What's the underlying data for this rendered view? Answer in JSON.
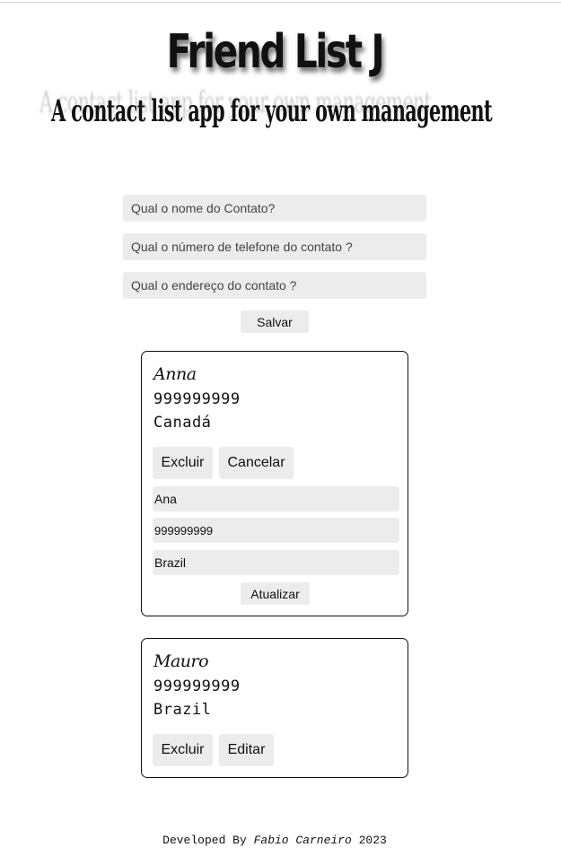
{
  "header": {
    "title": "Friend List J",
    "subtitle": "A contact list app for your own management"
  },
  "form": {
    "name_placeholder": "Qual o nome do Contato?",
    "phone_placeholder": "Qual o número de telefone do contato ?",
    "address_placeholder": "Qual o endereço do contato ?",
    "save_label": "Salvar"
  },
  "contacts": [
    {
      "name": "Anna",
      "phone": "999999999",
      "address": "Canadá",
      "delete_label": "Excluir",
      "cancel_label": "Cancelar",
      "edit": {
        "name_value": "Ana",
        "phone_value": "999999999",
        "address_value": "Brazil",
        "update_label": "Atualizar"
      }
    },
    {
      "name": "Mauro",
      "phone": "999999999",
      "address": "Brazil",
      "delete_label": "Excluir",
      "edit_label": "Editar"
    }
  ],
  "footer": {
    "prefix": "Developed By",
    "author": "Fabio Carneiro",
    "year": "2023"
  }
}
